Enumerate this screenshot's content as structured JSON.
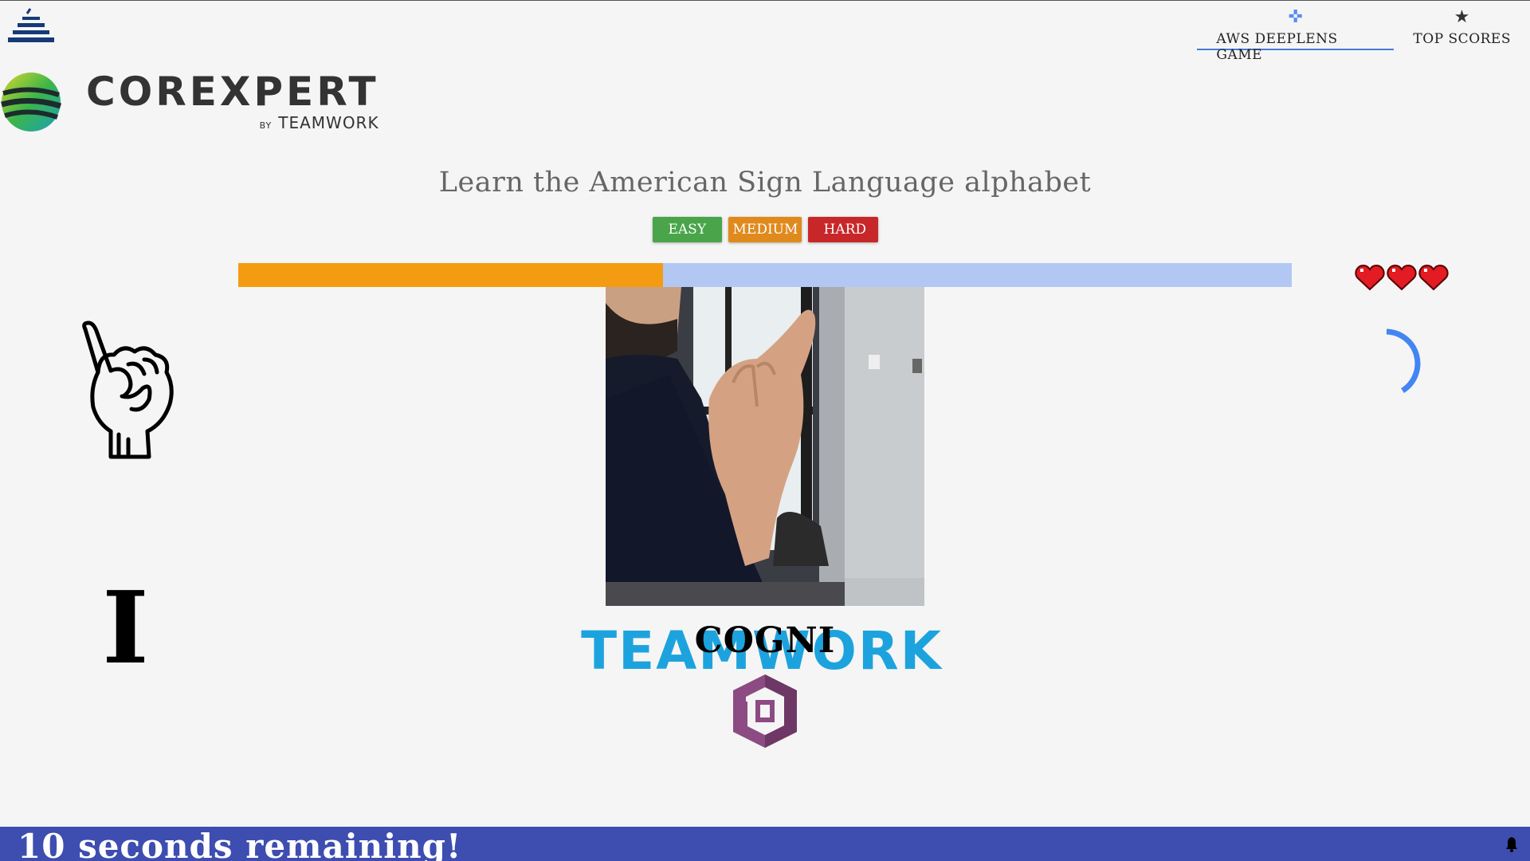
{
  "logos": {
    "teamwork_text": "TEAMWORK",
    "corexpert_text": "COREXPERT",
    "corexpert_by": "BY",
    "corexpert_by_brand": "TEAMWORK"
  },
  "nav": {
    "tabs": [
      {
        "label": "AWS DEEPLENS GAME",
        "icon": "gamepad-icon",
        "active": true
      },
      {
        "label": "TOP SCORES",
        "icon": "star-icon",
        "active": false
      }
    ]
  },
  "title": "Learn the American Sign Language alphabet",
  "difficulty": {
    "easy": "EASY",
    "medium": "MEDIUM",
    "hard": "HARD"
  },
  "progress": {
    "fraction": 0.403
  },
  "lives": {
    "count": 3,
    "max": 3
  },
  "current_letter": "I",
  "current_word": "COGNI",
  "status": {
    "message": "10 seconds remaining!"
  },
  "colors": {
    "accent": "#3e4db0",
    "progress_fill": "#f39c12",
    "progress_track": "#b2c8f2",
    "easy": "#4aa54a",
    "medium": "#e08a1e",
    "hard": "#c8272a",
    "heart": "#e31b23",
    "spinner": "#4285f4",
    "cognito": "#8c4b83"
  }
}
